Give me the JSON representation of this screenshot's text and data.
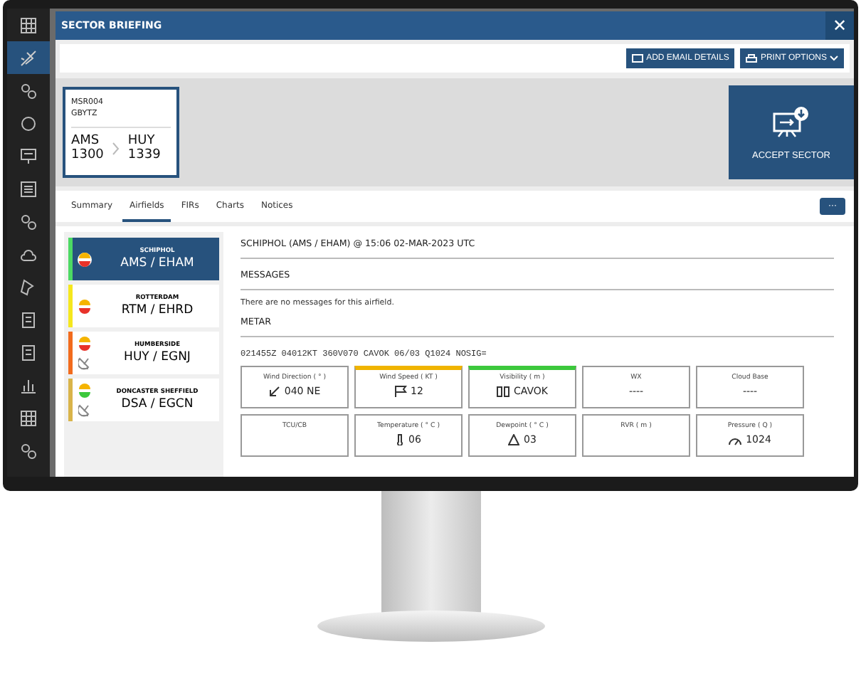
{
  "sidebar": {
    "items": [
      {
        "selected": false
      },
      {
        "selected": true
      },
      {
        "selected": false
      },
      {
        "selected": false
      },
      {
        "selected": false
      },
      {
        "selected": false
      },
      {
        "selected": false
      },
      {
        "selected": false
      },
      {
        "selected": false
      },
      {
        "selected": false
      },
      {
        "selected": false
      },
      {
        "selected": false
      },
      {
        "selected": false
      },
      {
        "selected": false
      }
    ]
  },
  "window": {
    "title": "SECTOR BRIEFING",
    "close": "✕"
  },
  "toolbar": {
    "buttons": [
      {
        "label": "ADD EMAIL DETAILS",
        "kind": "email"
      },
      {
        "label": "PRINT OPTIONS",
        "kind": "print"
      }
    ]
  },
  "flight_card": {
    "flight": "MSR004",
    "registration": "GBYTZ",
    "from_code": "AMS",
    "from_time": "1300",
    "to_code": "HUY",
    "to_time": "1339"
  },
  "accept_button": {
    "label": "ACCEPT SECTOR"
  },
  "tabs": [
    {
      "label": "Summary",
      "selected": false
    },
    {
      "label": "Airfields",
      "selected": true
    },
    {
      "label": "FIRs",
      "selected": false
    },
    {
      "label": "Charts",
      "selected": false
    },
    {
      "label": "Notices",
      "selected": false
    }
  ],
  "more_button": {
    "label": "···"
  },
  "airfields": [
    {
      "name": "SCHIPHOL",
      "code": "AMS / EHAM",
      "color": "#4cd964",
      "selected": true,
      "alert": true,
      "radar": false
    },
    {
      "name": "ROTTERDAM",
      "code": "RTM / EHRD",
      "color": "#f5e71e",
      "selected": false,
      "alert": true,
      "radar": false
    },
    {
      "name": "HUMBERSIDE",
      "code": "HUY / EGNJ",
      "color": "#f26b1d",
      "selected": false,
      "alert": true,
      "radar": true
    },
    {
      "name": "DONCASTER SHEFFIELD",
      "code": "DSA / EGCN",
      "color": "#d9b44a",
      "selected": false,
      "alert": false,
      "radar": true
    }
  ],
  "detail": {
    "heading": "SCHIPHOL (AMS / EHAM) @ 15:06 02-MAR-2023 UTC",
    "messages_title": "MESSAGES",
    "messages_text": "There are no messages for this airfield.",
    "metar_title": "METAR",
    "metar": "021455Z 04012KT 360V070 CAVOK 06/03 Q1024 NOSIG=",
    "cards": [
      {
        "label": "Wind Direction ( ° )",
        "value": "040 NE"
      },
      {
        "label": "Wind Speed ( KT )",
        "value": "12",
        "color": "#f0b400"
      },
      {
        "label": "Visibility ( m )",
        "value": "CAVOK",
        "color": "#3cc83c"
      },
      {
        "label": "WX",
        "value": "----"
      },
      {
        "label": "Cloud Base",
        "value": "----"
      },
      {
        "label": "TCU/CB"
      },
      {
        "label": "Temperature ( ° C )",
        "value": "06"
      },
      {
        "label": "Dewpoint ( ° C )",
        "value": "03"
      },
      {
        "label": "RVR ( m )"
      },
      {
        "label": "Pressure ( Q )",
        "value": "1024"
      }
    ]
  }
}
